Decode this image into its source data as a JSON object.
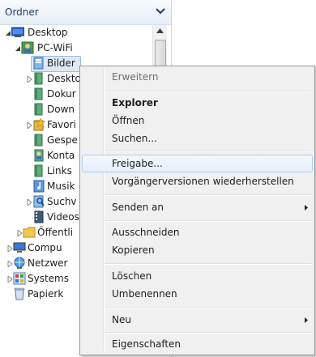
{
  "nav": {
    "header_title": "Ordner",
    "header_chevron_icon": "chevron-down-icon",
    "tree": [
      {
        "label": "Desktop",
        "icon": "desktop-icon",
        "expander": "expanded"
      },
      {
        "label": "PC-WiFi",
        "icon": "user-folder-icon",
        "expander": "expanded"
      },
      {
        "label": "Bilder",
        "icon": "library-folder-icon",
        "expander": "none",
        "selected": true
      },
      {
        "label": "Desktop",
        "icon": "folder-icon",
        "expander": "collapsed"
      },
      {
        "label": "Dokumente",
        "icon": "folder-icon",
        "expander": "none"
      },
      {
        "label": "Downloads",
        "icon": "folder-icon",
        "expander": "none"
      },
      {
        "label": "Favoriten",
        "icon": "favorites-icon",
        "expander": "collapsed"
      },
      {
        "label": "Gespeicherte Spiele",
        "icon": "folder-icon",
        "expander": "none"
      },
      {
        "label": "Kontakte",
        "icon": "contacts-icon",
        "expander": "none"
      },
      {
        "label": "Links",
        "icon": "folder-icon",
        "expander": "none"
      },
      {
        "label": "Musik",
        "icon": "music-icon",
        "expander": "none"
      },
      {
        "label": "Suchvorgänge",
        "icon": "search-folder-icon",
        "expander": "collapsed"
      },
      {
        "label": "Videos",
        "icon": "video-icon",
        "expander": "none"
      },
      {
        "label": "Öffentlich",
        "icon": "folder-yellow-icon",
        "expander": "collapsed"
      },
      {
        "label": "Computer",
        "icon": "computer-icon",
        "expander": "collapsed"
      },
      {
        "label": "Netzwerk",
        "icon": "network-icon",
        "expander": "collapsed"
      },
      {
        "label": "Systemsteuerung",
        "icon": "control-panel-icon",
        "expander": "collapsed"
      },
      {
        "label": "Papierkorb",
        "icon": "recycle-bin-icon",
        "expander": "none"
      }
    ],
    "visible_labels": {
      "r0": "Desktop",
      "r1": "PC-WiFi",
      "r2": "Bilder",
      "r3": "Deskto",
      "r4": "Dokur",
      "r5": "Down",
      "r6": "Favori",
      "r7": "Gespe",
      "r8": "Konta",
      "r9": "Links",
      "r10": "Musik",
      "r11": "Suchv",
      "r12": "Videos",
      "r13": "Öffentli",
      "r14": "Compu",
      "r15": "Netzwer",
      "r16": "Systems",
      "r17": "Papierk"
    }
  },
  "context_menu": {
    "items": {
      "erweitern": "Erweitern",
      "explorer": "Explorer",
      "oeffnen": "Öffnen",
      "suchen": "Suchen...",
      "freigabe": "Freigabe...",
      "vorgaenger": "Vorgängerversionen wiederherstellen",
      "senden_an": "Senden an",
      "ausschneiden": "Ausschneiden",
      "kopieren": "Kopieren",
      "loeschen": "Löschen",
      "umbenennen": "Umbenennen",
      "neu": "Neu",
      "eigenschaften": "Eigenschaften"
    },
    "hovered_item": "Freigabe...",
    "disabled_item": "Erweitern",
    "default_item": "Explorer",
    "submenu_arrow_icon": "submenu-arrow-icon"
  },
  "colors": {
    "nav_header_text": "#1e395b",
    "selection_bg": "#dde9f7",
    "hover_border": "#aecff7",
    "menu_bg": "#f0f0f0"
  }
}
